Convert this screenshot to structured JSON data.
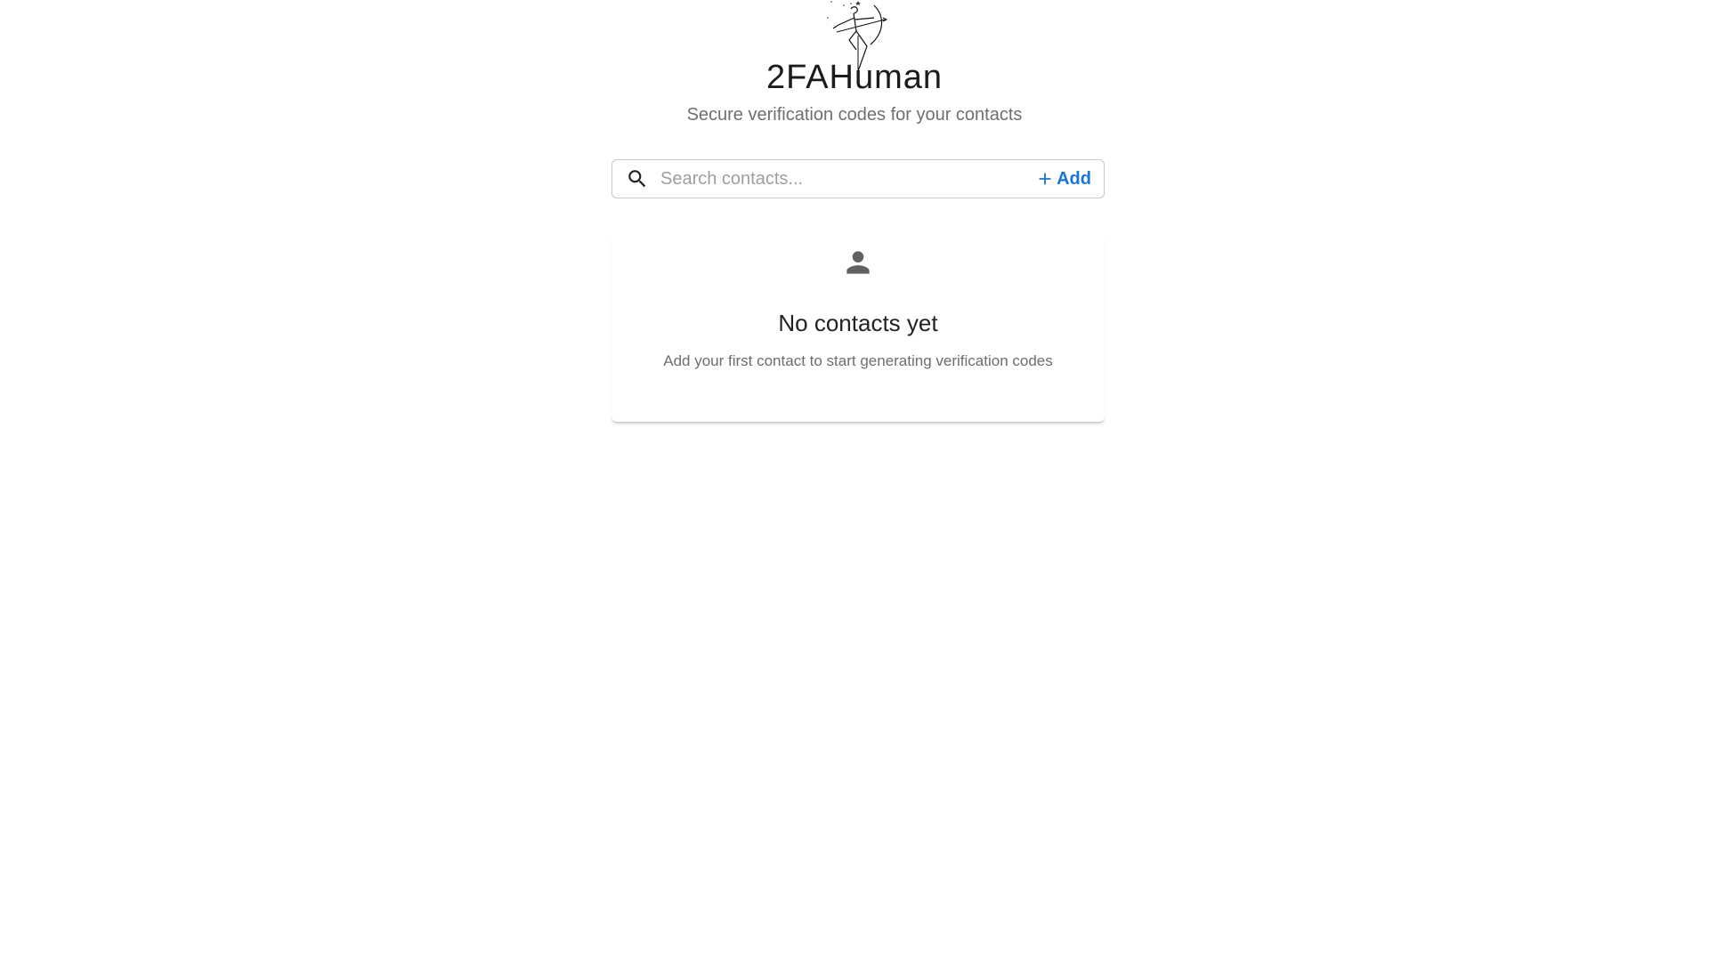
{
  "app": {
    "title": "2FAHuman",
    "tagline": "Secure verification codes for your contacts",
    "logo": "archer-logo"
  },
  "search": {
    "placeholder": "Search contacts...",
    "value": "",
    "icon": "search-icon"
  },
  "add_button": {
    "label": "Add",
    "icon": "plus-icon"
  },
  "empty_state": {
    "icon": "person-icon",
    "title": "No contacts yet",
    "description": "Add your first contact to start generating verification codes"
  },
  "colors": {
    "accent": "#1976d2",
    "text_primary": "#222222",
    "text_secondary": "#6d6d6d",
    "icon_gray": "#616161"
  }
}
